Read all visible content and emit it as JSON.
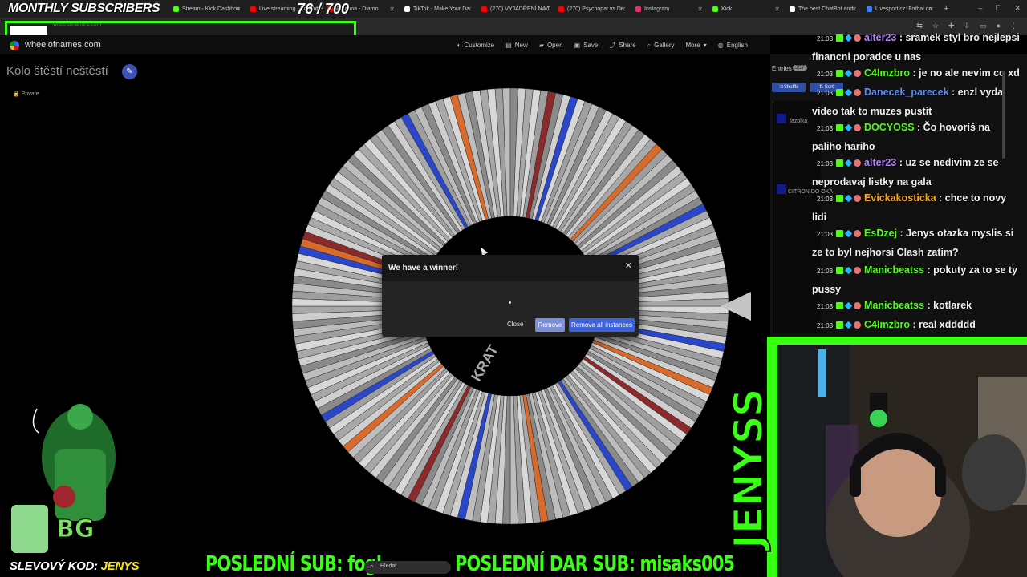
{
  "overlay": {
    "subs_title": "MONTHLY SUBSCRIBERS",
    "subs_count": "76  / 700",
    "subs_progress": 0.109,
    "code_label": "SLEVOVÝ KOD:",
    "code_value": "JENYS",
    "last_sub": "POSLEDNÍ SUB: fogl",
    "last_donation": "POSLEDNÍ DAR SUB: misaks005",
    "streamer_name": "JENYSS"
  },
  "browser": {
    "tabs": [
      {
        "label": "Stream - Kick Dashboa",
        "color": "#53fc18"
      },
      {
        "label": "Live streaming - YouTube",
        "color": "#ff0000"
      },
      {
        "label": "Rihanna - Diamo",
        "color": "#ff0000"
      },
      {
        "label": "TikTok - Make Your Da",
        "color": "#ffffff"
      },
      {
        "label": "(270) VYJÁDŘENÍ NA T",
        "color": "#ff0000"
      },
      {
        "label": "(270) Psychopat vs Dr",
        "color": "#ff0000"
      },
      {
        "label": "Instagram",
        "color": "#e1306c"
      },
      {
        "label": "Kick",
        "color": "#53fc18"
      },
      {
        "label": "The best ChatBot and",
        "color": "#ffffff"
      },
      {
        "label": "Livesport.cz: Fotbal on",
        "color": "#3b82f6"
      }
    ],
    "url": "wheelofnames.com"
  },
  "app": {
    "site_name": "wheelofnames.com",
    "menu": [
      {
        "label": "Customize",
        "icon": "palette-icon"
      },
      {
        "label": "New",
        "icon": "file-icon"
      },
      {
        "label": "Open",
        "icon": "folder-icon"
      },
      {
        "label": "Save",
        "icon": "save-icon"
      },
      {
        "label": "Share",
        "icon": "share-icon"
      },
      {
        "label": "Gallery",
        "icon": "search-icon"
      },
      {
        "label": "More",
        "icon": "chevron-down-icon"
      },
      {
        "label": "English",
        "icon": "globe-icon"
      }
    ],
    "wheel_title": "Kolo štěstí neštěstí",
    "privacy": "Private",
    "wheel_center_text": "KRAT"
  },
  "dialog": {
    "title": "We have a winner!",
    "close_label": "Close",
    "remove_label": "Remove",
    "remove_all_label": "Remove all instances"
  },
  "entries": {
    "tab_label": "Entries",
    "count": "357",
    "shuffle_label": "Shuffle",
    "sort_label": "Sort",
    "items": [
      "fazolka",
      "CITRON DO OKA"
    ]
  },
  "chat": {
    "messages": [
      {
        "time": "21:03",
        "user": "alter23",
        "color": "#b085f5",
        "text": "sramek styl bro nejlepsi financni poradce u nas"
      },
      {
        "time": "21:03",
        "user": "C4lmzbro",
        "color": "#53fc18",
        "text": "je no ale nevim co xd"
      },
      {
        "time": "21:03",
        "user": "Danecek_parecek",
        "color": "#5b8def",
        "text": "enzl vydal video tak to muzes pustit"
      },
      {
        "time": "21:03",
        "user": "DOCYOSS",
        "color": "#53fc18",
        "text": "Čo hovoríš na paliho hariho"
      },
      {
        "time": "21:03",
        "user": "alter23",
        "color": "#b085f5",
        "text": "uz se nedivim ze se neprodavaj listky na gala"
      },
      {
        "time": "21:03",
        "user": "Evickakosticka",
        "color": "#f5a623",
        "text": "chce to novy lidi"
      },
      {
        "time": "21:03",
        "user": "EsDzej",
        "color": "#53fc18",
        "text": "Jenys otazka myslis si ze to byl nejhorsi Clash zatim?"
      },
      {
        "time": "21:03",
        "user": "Manicbeatss",
        "color": "#53fc18",
        "text": "pokuty za to se ty pussy"
      },
      {
        "time": "21:03",
        "user": "Manicbeatss",
        "color": "#53fc18",
        "text": "kotlarek"
      },
      {
        "time": "21:03",
        "user": "C4lmzbro",
        "color": "#53fc18",
        "text": "real xddddd"
      }
    ]
  },
  "taskbar": {
    "search_placeholder": "Hledat"
  }
}
